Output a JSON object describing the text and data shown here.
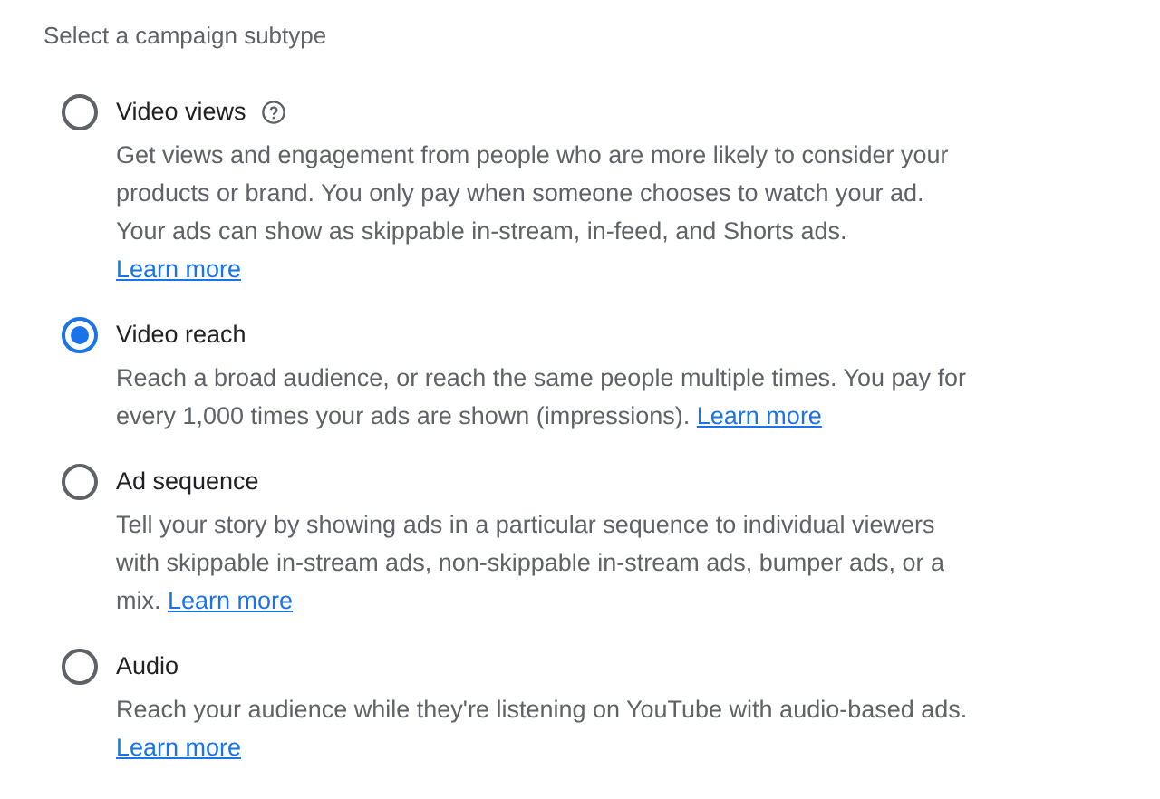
{
  "heading": "Select a campaign subtype",
  "options": [
    {
      "label": "Video views",
      "selected": false,
      "help_icon": true,
      "description": [
        "Get views and engagement from people who are more likely to consider your",
        "products or brand. You only pay when someone chooses to watch your ad.",
        "Your ads can show as skippable in-stream, in-feed, and Shorts ads."
      ],
      "link": "Learn more",
      "link_on_new_line": true
    },
    {
      "label": "Video reach",
      "selected": true,
      "help_icon": false,
      "description": [
        "Reach a broad audience, or reach the same people multiple times. You pay for",
        "every 1,000 times your ads are shown (impressions)."
      ],
      "link": "Learn more",
      "link_on_new_line": false
    },
    {
      "label": "Ad sequence",
      "selected": false,
      "help_icon": false,
      "description": [
        "Tell your story by showing ads in a particular sequence to individual viewers",
        "with skippable in-stream ads, non-skippable in-stream ads, bumper ads, or a",
        "mix."
      ],
      "link": "Learn more",
      "link_on_new_line": false
    },
    {
      "label": "Audio",
      "selected": false,
      "help_icon": false,
      "description": [
        "Reach your audience while they're listening on YouTube with audio-based ads."
      ],
      "link": "Learn more",
      "link_on_new_line": true
    }
  ]
}
